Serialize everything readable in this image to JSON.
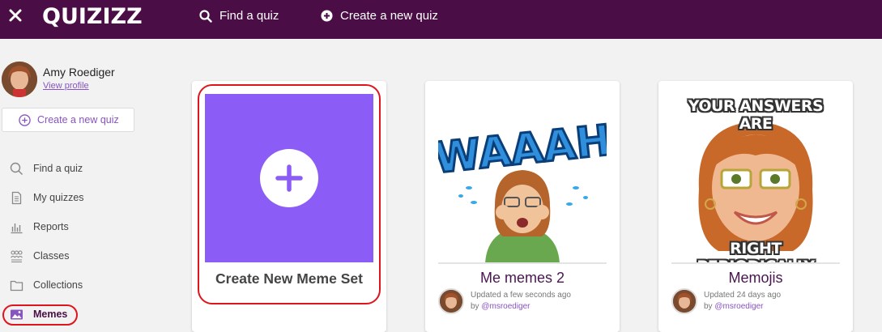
{
  "topbar": {
    "logo": "QUIZIZZ",
    "find_quiz": "Find a quiz",
    "create_quiz": "Create a new quiz"
  },
  "profile": {
    "name": "Amy Roediger",
    "view_profile": "View profile"
  },
  "sidebar": {
    "create_button": "Create a new quiz",
    "items": [
      {
        "label": "Find a quiz",
        "icon": "search-icon"
      },
      {
        "label": "My quizzes",
        "icon": "document-icon"
      },
      {
        "label": "Reports",
        "icon": "bar-chart-icon"
      },
      {
        "label": "Classes",
        "icon": "people-icon"
      },
      {
        "label": "Collections",
        "icon": "folder-icon"
      },
      {
        "label": "Memes",
        "icon": "image-icon",
        "active": true
      }
    ]
  },
  "cards": {
    "create": {
      "title": "Create New Meme Set"
    },
    "set1": {
      "title": "Me memes 2",
      "meme_text": "WAAAH",
      "updated": "Updated a few seconds ago",
      "by_prefix": "by",
      "user": "@msroediger"
    },
    "set2": {
      "title": "Memojis",
      "caption_top": "YOUR ANSWERS ARE",
      "caption_bottom": "RIGHT PERIODICALLY",
      "updated": "Updated 24 days ago",
      "by_prefix": "by",
      "user": "@msroediger"
    }
  },
  "colors": {
    "topbar": "#4a0d45",
    "accent": "#8854c0",
    "tile": "#8b5cf6",
    "highlight": "#e0141d"
  }
}
